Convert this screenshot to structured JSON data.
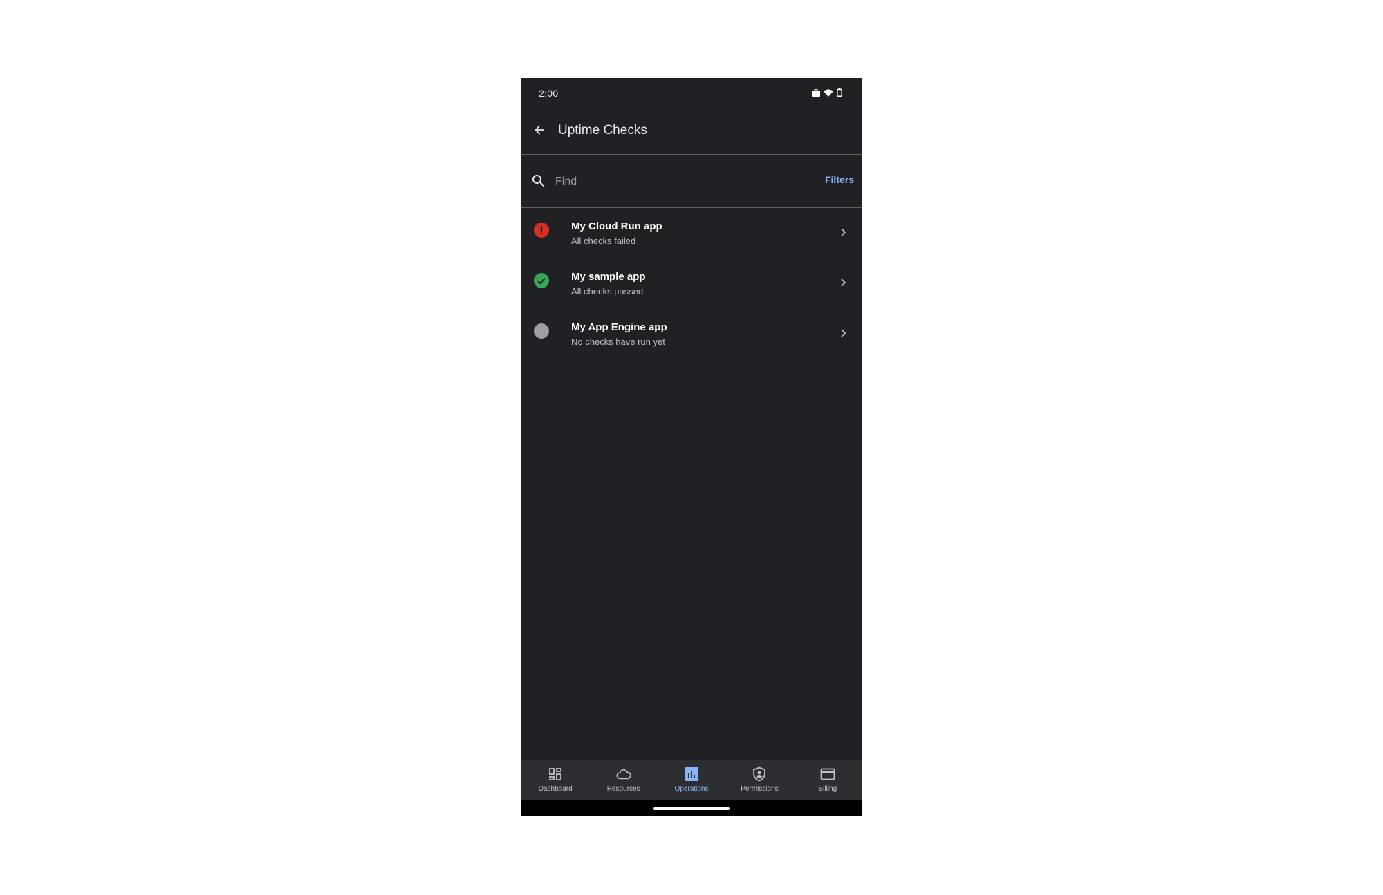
{
  "status_bar": {
    "time": "2:00",
    "icons": [
      "work-profile-icon",
      "wifi-icon",
      "battery-icon"
    ]
  },
  "app_bar": {
    "back_icon": "arrow-back-icon",
    "title": "Uptime Checks"
  },
  "search": {
    "icon": "search-icon",
    "placeholder": "Find",
    "value": "",
    "filters_label": "Filters"
  },
  "checks": [
    {
      "name": "My Cloud Run app",
      "status_text": "All checks failed",
      "status": "failed",
      "color": "#d93025"
    },
    {
      "name": "My sample app",
      "status_text": "All checks passed",
      "status": "passed",
      "color": "#34a853"
    },
    {
      "name": "My App Engine app",
      "status_text": "No checks have run yet",
      "status": "none",
      "color": "#9aa0a6"
    }
  ],
  "bottom_nav": {
    "items": [
      {
        "label": "Dashboard",
        "icon": "dashboard-icon",
        "active": false
      },
      {
        "label": "Resources",
        "icon": "cloud-icon",
        "active": false
      },
      {
        "label": "Operations",
        "icon": "bar-chart-icon",
        "active": true
      },
      {
        "label": "Permissions",
        "icon": "shield-user-icon",
        "active": false
      },
      {
        "label": "Billing",
        "icon": "credit-card-icon",
        "active": false
      }
    ]
  },
  "colors": {
    "background": "#202124",
    "accent": "#8ab4f8",
    "nav_background": "#2d2e31"
  }
}
